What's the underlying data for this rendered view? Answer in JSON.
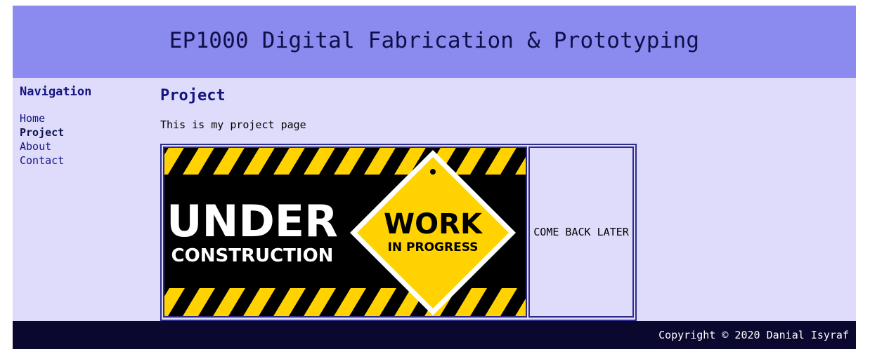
{
  "header": {
    "title": "EP1000 Digital Fabrication & Prototyping"
  },
  "nav": {
    "heading": "Navigation",
    "items": [
      {
        "label": "Home"
      },
      {
        "label": "Project"
      },
      {
        "label": "About"
      },
      {
        "label": "Contact"
      }
    ],
    "active": "Project"
  },
  "main": {
    "title": "Project",
    "intro": "This is my project page",
    "banner": {
      "line1": "UNDER",
      "line2": "CONSTRUCTION",
      "sign_line1": "WORK",
      "sign_line2": "IN PROGRESS"
    },
    "side_note": "COME BACK LATER"
  },
  "footer": {
    "copyright": "Copyright © 2020 Danial Isyraf"
  },
  "colors": {
    "header_bg": "#8a8aef",
    "content_bg": "#dedcfa",
    "footer_bg": "#0b0830",
    "link": "#141480",
    "stripe_yellow": "#ffd200"
  }
}
